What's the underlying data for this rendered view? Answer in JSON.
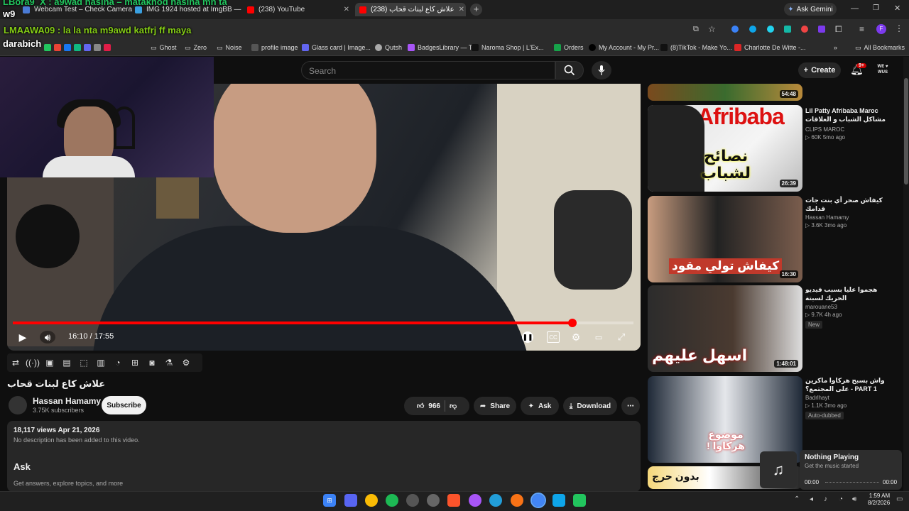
{
  "tabs": [
    {
      "label": "Webcam Test – Check Camera"
    },
    {
      "label": "IMG 1924 hosted at ImgBB —"
    },
    {
      "label": "(238) YouTube"
    },
    {
      "label": "(238) علاش كاع لبنات قحاب"
    }
  ],
  "ask_gemini": "Ask Gemini",
  "chat_overlay": {
    "line1": "LBora9_X : a9wad hasina – matakhod hasina mn ta",
    "line1b": "w9",
    "line2": "LMAAWA09 : la la nta m9awd katfrj ff maya",
    "line3": "darabich"
  },
  "bookmarks": [
    "Ghost",
    "Zero",
    "Noise",
    "profile image",
    "Glass card | Image...",
    "Qutsh",
    "BadgesLibrary — T...",
    "Naroma Shop | L'Ex...",
    "Orders",
    "My Account - My Pr...",
    "(8)TikTok - Make Yo...",
    "Charlotte De Witte -..."
  ],
  "all_bookmarks": "All Bookmarks",
  "header": {
    "search_placeholder": "Search",
    "create": "Create",
    "notif_count": "9+"
  },
  "player": {
    "time": "16:10 / 17:55",
    "progress_fraction": 0.902
  },
  "video": {
    "title": "علاش كاع لبنات قحاب",
    "channel": "Hassan Hamamy",
    "subscribers": "3.75K subscribers",
    "subscribe": "Subscribe",
    "likes": "966",
    "share": "Share",
    "ask": "Ask",
    "download": "Download",
    "views_date": "18,117 views  Apr 21, 2026",
    "description": "No description has been added to this video.",
    "ask_heading": "Ask",
    "ask_sub": "Get answers, explore topics, and more"
  },
  "sidebar": [
    {
      "duration": "54:48",
      "title": "",
      "channel": "",
      "stats": ""
    },
    {
      "duration": "26:39",
      "title": "Lil Patty Afribaba Maroc مشاكل الشباب و العلاقات الرومانسية في المغرب",
      "channel": "CLIPS MAROC",
      "stats": "60K  5mo ago",
      "thumb_text": "Afribaba",
      "thumb_text2": "نصائح لشباب"
    },
    {
      "duration": "16:30",
      "title": "كيفاش صحر أي بنت جات قدامك",
      "channel": "Hassan Hamamy",
      "stats": "3.6K  3mo ago",
      "thumb_text": "كيفاش تولي مقود"
    },
    {
      "duration": "1:48:01",
      "title": "هجموا عليا بسبب فيديو الحريك لسبتة",
      "channel": "marouane53",
      "stats": "9.7K  4h ago",
      "badge": "New",
      "thumb_text": "اسهل عليهم"
    },
    {
      "duration": "",
      "title": "واش بسبح هركاوا ماكرين على المجتمع؟ - PART 1",
      "channel": "Badrlhayt",
      "stats": "1.1K  3mo ago",
      "badge": "Auto-dubbed",
      "thumb_text": "موضوع هركاوا !"
    },
    {
      "duration": "",
      "title": "",
      "channel": "",
      "stats": "",
      "thumb_text": "بدون حرج"
    }
  ],
  "now_playing": {
    "title": "Nothing Playing",
    "sub": "Get the music started",
    "t_start": "00:00",
    "t_end": "00:00"
  },
  "clock": {
    "time": "1:59 AM",
    "date": "8/2/2026"
  }
}
